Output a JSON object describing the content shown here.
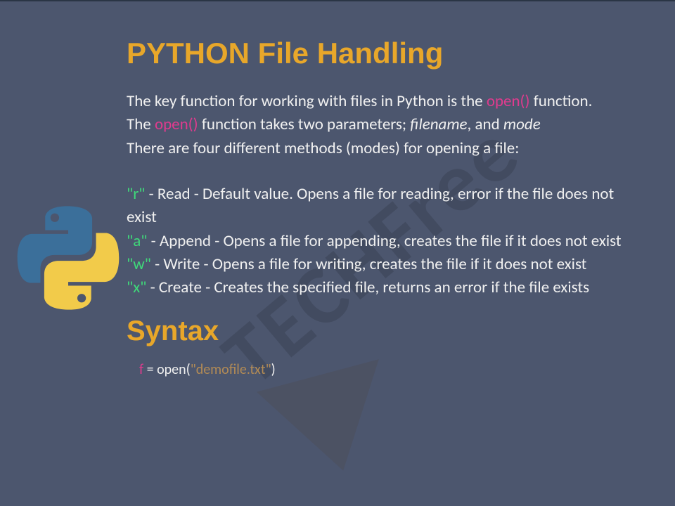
{
  "title": "PYTHON File Handling",
  "intro": {
    "line1_a": "The key function for working with files in Python is the ",
    "open_fn_1": " open() ",
    "line1_b": " function.",
    "line2_a": "The ",
    "open_fn_2": "open()",
    "line2_b": " function takes two parameters; ",
    "filename": "filename",
    "comma_and": ", and ",
    "mode": "mode",
    "line3": "There are four different methods (modes) for opening a file:"
  },
  "modes": [
    {
      "q": "\"r\"",
      "text": " - Read - Default value. Opens a file for reading, error if the file does not exist"
    },
    {
      "q": "\"a\"",
      "text": " - Append - Opens a file for appending, creates the file if it does not exist"
    },
    {
      "q": "\"w\"",
      "text": " - Write - Opens a file for writing, creates the file if it does not exist"
    },
    {
      "q": "\"x\"",
      "text": " - Create - Creates the specified file, returns an error if the file exists"
    }
  ],
  "syntax_heading": "Syntax",
  "syntax": {
    "fvar": "f",
    "eq_open": " = open(",
    "str": "\"demofile.txt\"",
    "close": ")"
  },
  "watermark": "TECHFree"
}
